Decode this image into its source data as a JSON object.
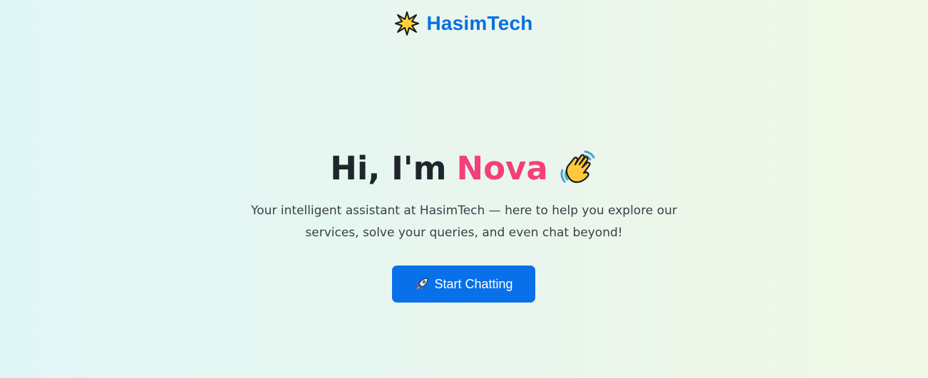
{
  "header": {
    "logo_icon": "sparkle-star-icon",
    "brand_name": "HasimTech"
  },
  "hero": {
    "greeting": "Hi, I'm",
    "assistant_name": "Nova",
    "wave_icon": "waving-hand-icon",
    "subtitle": "Your intelligent assistant at HasimTech — here to help you explore our services, solve your queries, and even chat beyond!"
  },
  "cta": {
    "icon": "rocket-icon",
    "label": "Start Chatting"
  },
  "colors": {
    "brand": "#0b6fe0",
    "accent_name": "#f43f7c",
    "button": "#0870e8",
    "title_text": "#1f252c"
  }
}
